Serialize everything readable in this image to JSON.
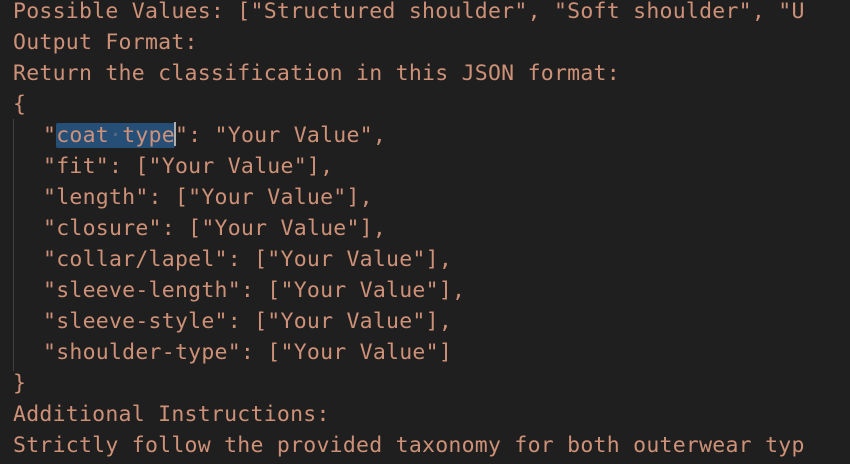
{
  "editor": {
    "lines": [
      "Possible Values: [\"Structured shoulder\", \"Soft shoulder\", \"U",
      "Output Format:",
      "Return the classification in this JSON format:",
      "{",
      "\"fit\": [\"Your Value\"],",
      "\"length\": [\"Your Value\"],",
      "\"closure\": [\"Your Value\"],",
      "\"collar/lapel\": [\"Your Value\"],",
      "\"sleeve-length\": [\"Your Value\"],",
      "\"sleeve-style\": [\"Your Value\"],",
      "\"shoulder-type\": [\"Your Value\"]",
      "}",
      "Additional Instructions:",
      "Strictly follow the provided taxonomy for both outerwear typ"
    ],
    "coat_line": {
      "prefix": "\"",
      "selected_word_1": "coat",
      "whitespace_marker": "·",
      "selected_word_2": "type",
      "suffix": "\": \"Your Value\","
    },
    "colors": {
      "background": "#1f1f1f",
      "string_text": "#ce9178",
      "selection": "#264f78",
      "indent_guide": "#404040",
      "cursor": "#aeafad"
    }
  }
}
